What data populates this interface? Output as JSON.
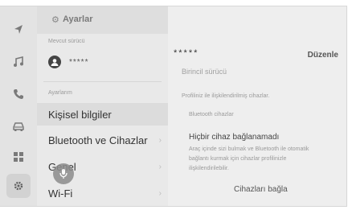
{
  "rail": {
    "items": [
      {
        "icon": "navigation-arrow-icon",
        "glyph": "➤"
      },
      {
        "icon": "music-note-icon",
        "glyph": "♫"
      },
      {
        "icon": "phone-icon",
        "glyph": "✆"
      },
      {
        "icon": "car-icon",
        "glyph": "⛍"
      },
      {
        "icon": "apps-grid-icon",
        "glyph": "▦"
      },
      {
        "icon": "settings-gear-icon",
        "glyph": "⚙"
      }
    ]
  },
  "settings": {
    "title": "Ayarlar",
    "current_driver_label": "Mevcut sürücü",
    "driver_name": "*****",
    "my_settings_label": "Ayarlarım",
    "menu": [
      {
        "label": "Kişisel bilgiler",
        "chevron": ""
      },
      {
        "label": "Bluetooth ve Cihazlar",
        "chevron": "›"
      },
      {
        "label": "Genel",
        "chevron": "›"
      },
      {
        "label": "Wi-Fi",
        "chevron": "›"
      }
    ]
  },
  "detail": {
    "masked_name": "*****",
    "edit_label": "Düzenle",
    "role": "Birincil sürücü",
    "hint": "Profiliniz ile ilişkilendirilmiş cihazlar.",
    "devices_label": "Bluetooth cihazlar",
    "no_device_title": "Hiçbir cihaz bağlanamadı",
    "no_device_desc": "Araç içinde sizi bulmak ve Bluetooth ile otomatik bağlantı kurmak için cihazlar profilinizle ilişkilendirilebilir.",
    "connect_label": "Cihazları bağla"
  },
  "mic": {
    "icon": "microphone-icon"
  }
}
